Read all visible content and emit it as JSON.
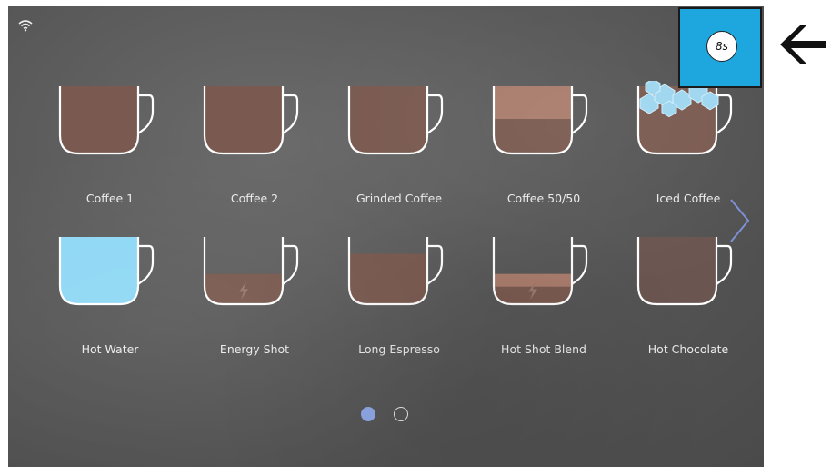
{
  "status": {
    "wifi_icon": "wifi-icon"
  },
  "drinks": [
    {
      "label": "Coffee 1",
      "fill": "#7a5a50",
      "level": 1.0
    },
    {
      "label": "Coffee 2",
      "fill": "#7a5a50",
      "level": 1.0
    },
    {
      "label": "Grinded Coffee",
      "fill": "#7a5a50",
      "level": 1.0
    },
    {
      "label": "Coffee 50/50",
      "fill": "#7a5a50",
      "top_fill": "#a97c6c",
      "level": 1.0
    },
    {
      "label": "Iced Coffee",
      "fill": "#7a5a50",
      "level": 1.0,
      "icon": "ice-cubes-icon"
    },
    {
      "label": "Hot Water",
      "fill": "#8fd8f5",
      "level": 1.0
    },
    {
      "label": "Energy Shot",
      "fill": "#7a5a50",
      "level": 0.45,
      "icon": "lightning-icon"
    },
    {
      "label": "Long Espresso",
      "fill": "#7a5a50",
      "level": 0.75
    },
    {
      "label": "Hot Shot Blend",
      "fill": "#7a5a50",
      "top_fill": "#a97c6c",
      "level": 0.45,
      "icon": "lightning-icon"
    },
    {
      "label": "Hot Chocolate",
      "fill": "#6b5550",
      "level": 1.0
    }
  ],
  "pagination": {
    "current": 1,
    "total": 2,
    "active_color": "#8ea8e6"
  },
  "timer": {
    "value": "8s",
    "color": "#1ea6df"
  },
  "navigation": {
    "next_icon": "chevron-right-icon",
    "back_icon": "arrow-left-icon"
  }
}
